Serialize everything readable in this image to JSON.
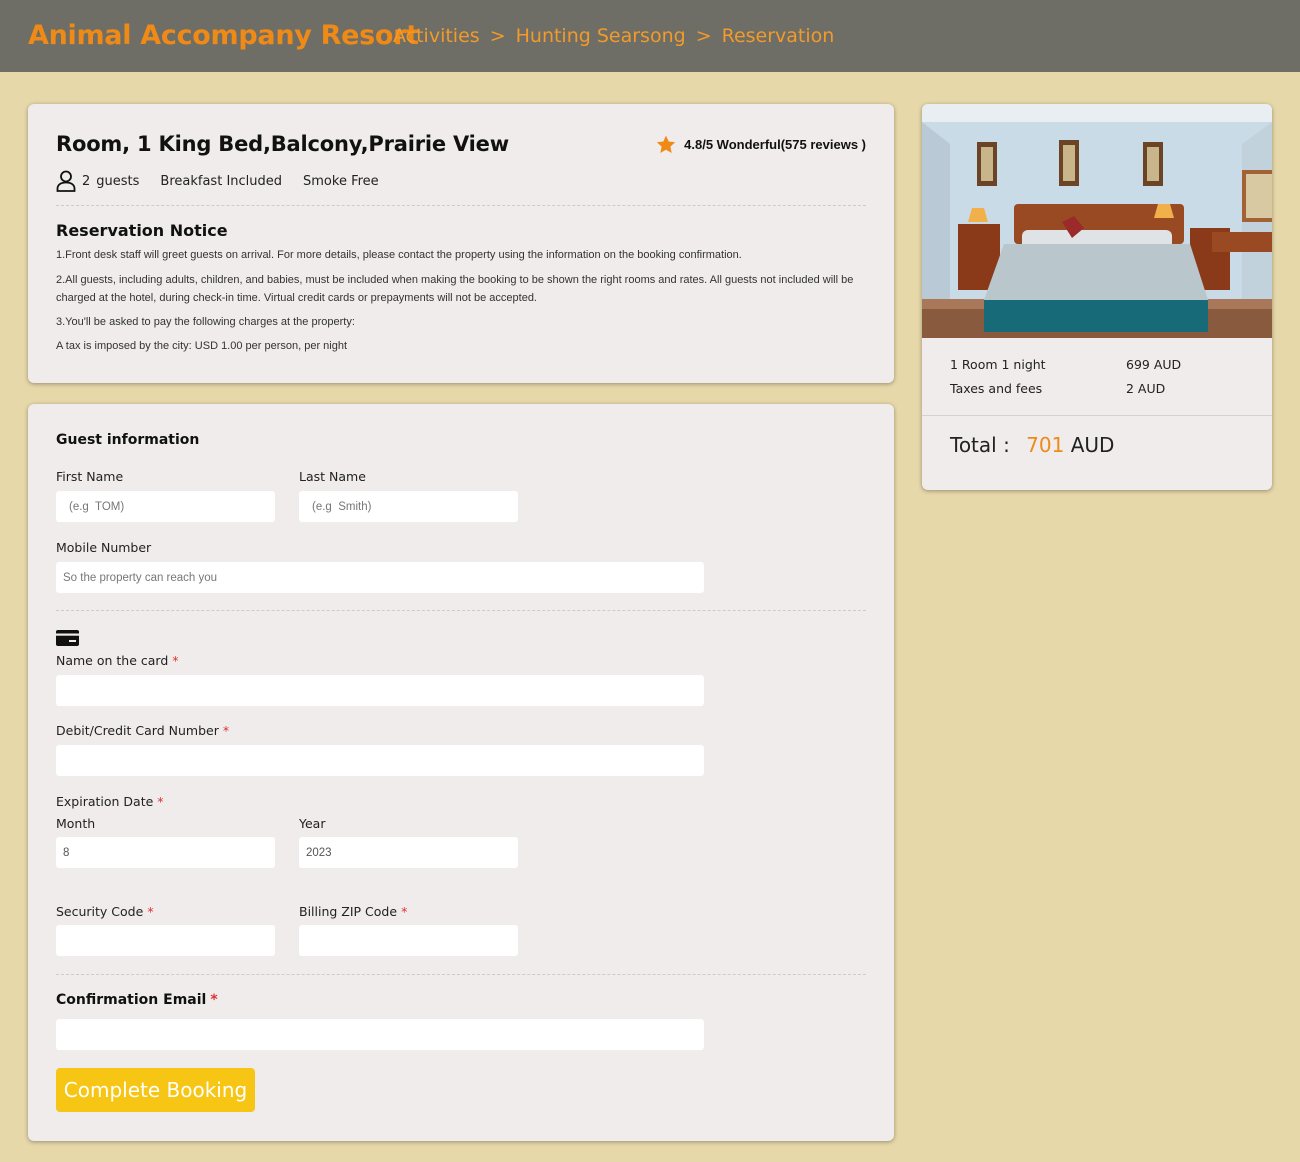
{
  "header": {
    "brand": "Animal Accompany Resort",
    "breadcrumb": [
      "Activities",
      "Hunting Searsong",
      "Reservation"
    ],
    "separator": ">"
  },
  "room": {
    "title": "Room, 1 King Bed,Balcony,Prairie View",
    "rating": "4.8/5 Wonderful(575 reviews )",
    "guests_count": "2",
    "guests_label": "guests",
    "features": [
      "Breakfast Included",
      "Smoke Free"
    ],
    "notice_title": "Reservation Notice",
    "notices": [
      "1.Front desk staff will greet guests on arrival. For more details, please contact the property using the information on the booking confirmation.",
      "2.All guests, including adults, children, and babies, must be included when making the booking to be shown the right rooms and rates. All guests not included will be charged at the hotel, during check-in time. Virtual credit cards or prepayments will not be accepted.",
      "3.You'll be asked to pay the following charges at the property:",
      "A tax is imposed by the city: USD 1.00 per person, per night"
    ]
  },
  "form": {
    "guest_title": "Guest information",
    "first_name_label": "First Name",
    "first_name_placeholder": "(e.g  TOM)",
    "last_name_label": "Last Name",
    "last_name_placeholder": "(e.g  Smith)",
    "mobile_label": "Mobile Number",
    "mobile_placeholder": "So the property can reach you",
    "card_name_label": "Name on the card",
    "card_number_label": "Debit/Credit Card Number",
    "expiration_label": "Expiration Date",
    "month_label": "Month",
    "month_value": "8",
    "year_label": "Year",
    "year_value": "2023",
    "security_label": "Security Code",
    "zip_label": "Billing ZIP Code",
    "email_label": "Confirmation Email",
    "required_mark": "*",
    "submit_label": "Complete Booking"
  },
  "price": {
    "room_label": "1 Room 1 night",
    "room_value": "699 AUD",
    "taxes_label": "Taxes and fees",
    "taxes_value": "2 AUD",
    "total_label": "Total :",
    "total_amount": "701",
    "total_currency": "AUD"
  },
  "colors": {
    "accent": "#ef8a17",
    "button": "#f7c513",
    "background": "#e6d8a9",
    "header": "#6e6e66",
    "required": "#e0302f"
  }
}
